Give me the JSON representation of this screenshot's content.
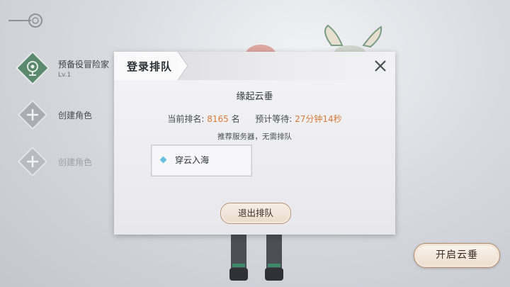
{
  "slots": [
    {
      "name": "预备役冒险家",
      "level": "Lv.1",
      "icon": "character-emblem-icon"
    },
    {
      "name": "创建角色",
      "icon": "plus-icon"
    },
    {
      "name": "创建角色",
      "icon": "plus-icon"
    }
  ],
  "queue_dialog": {
    "title": "登录排队",
    "server_name": "缘起云垂",
    "rank_label": "当前排名:",
    "rank_value": "8165",
    "rank_unit": "名",
    "wait_label": "预计等待:",
    "wait_value": "27分钟14秒",
    "recommend_text": "推荐服务器，无需排队",
    "recommended_server": "穿云入海",
    "exit_label": "退出排队"
  },
  "start_button_label": "开启云垂",
  "colors": {
    "accent": "#d87a3c",
    "server_dot": "#66c0dd",
    "emblem_green": "#5b8a6e"
  }
}
